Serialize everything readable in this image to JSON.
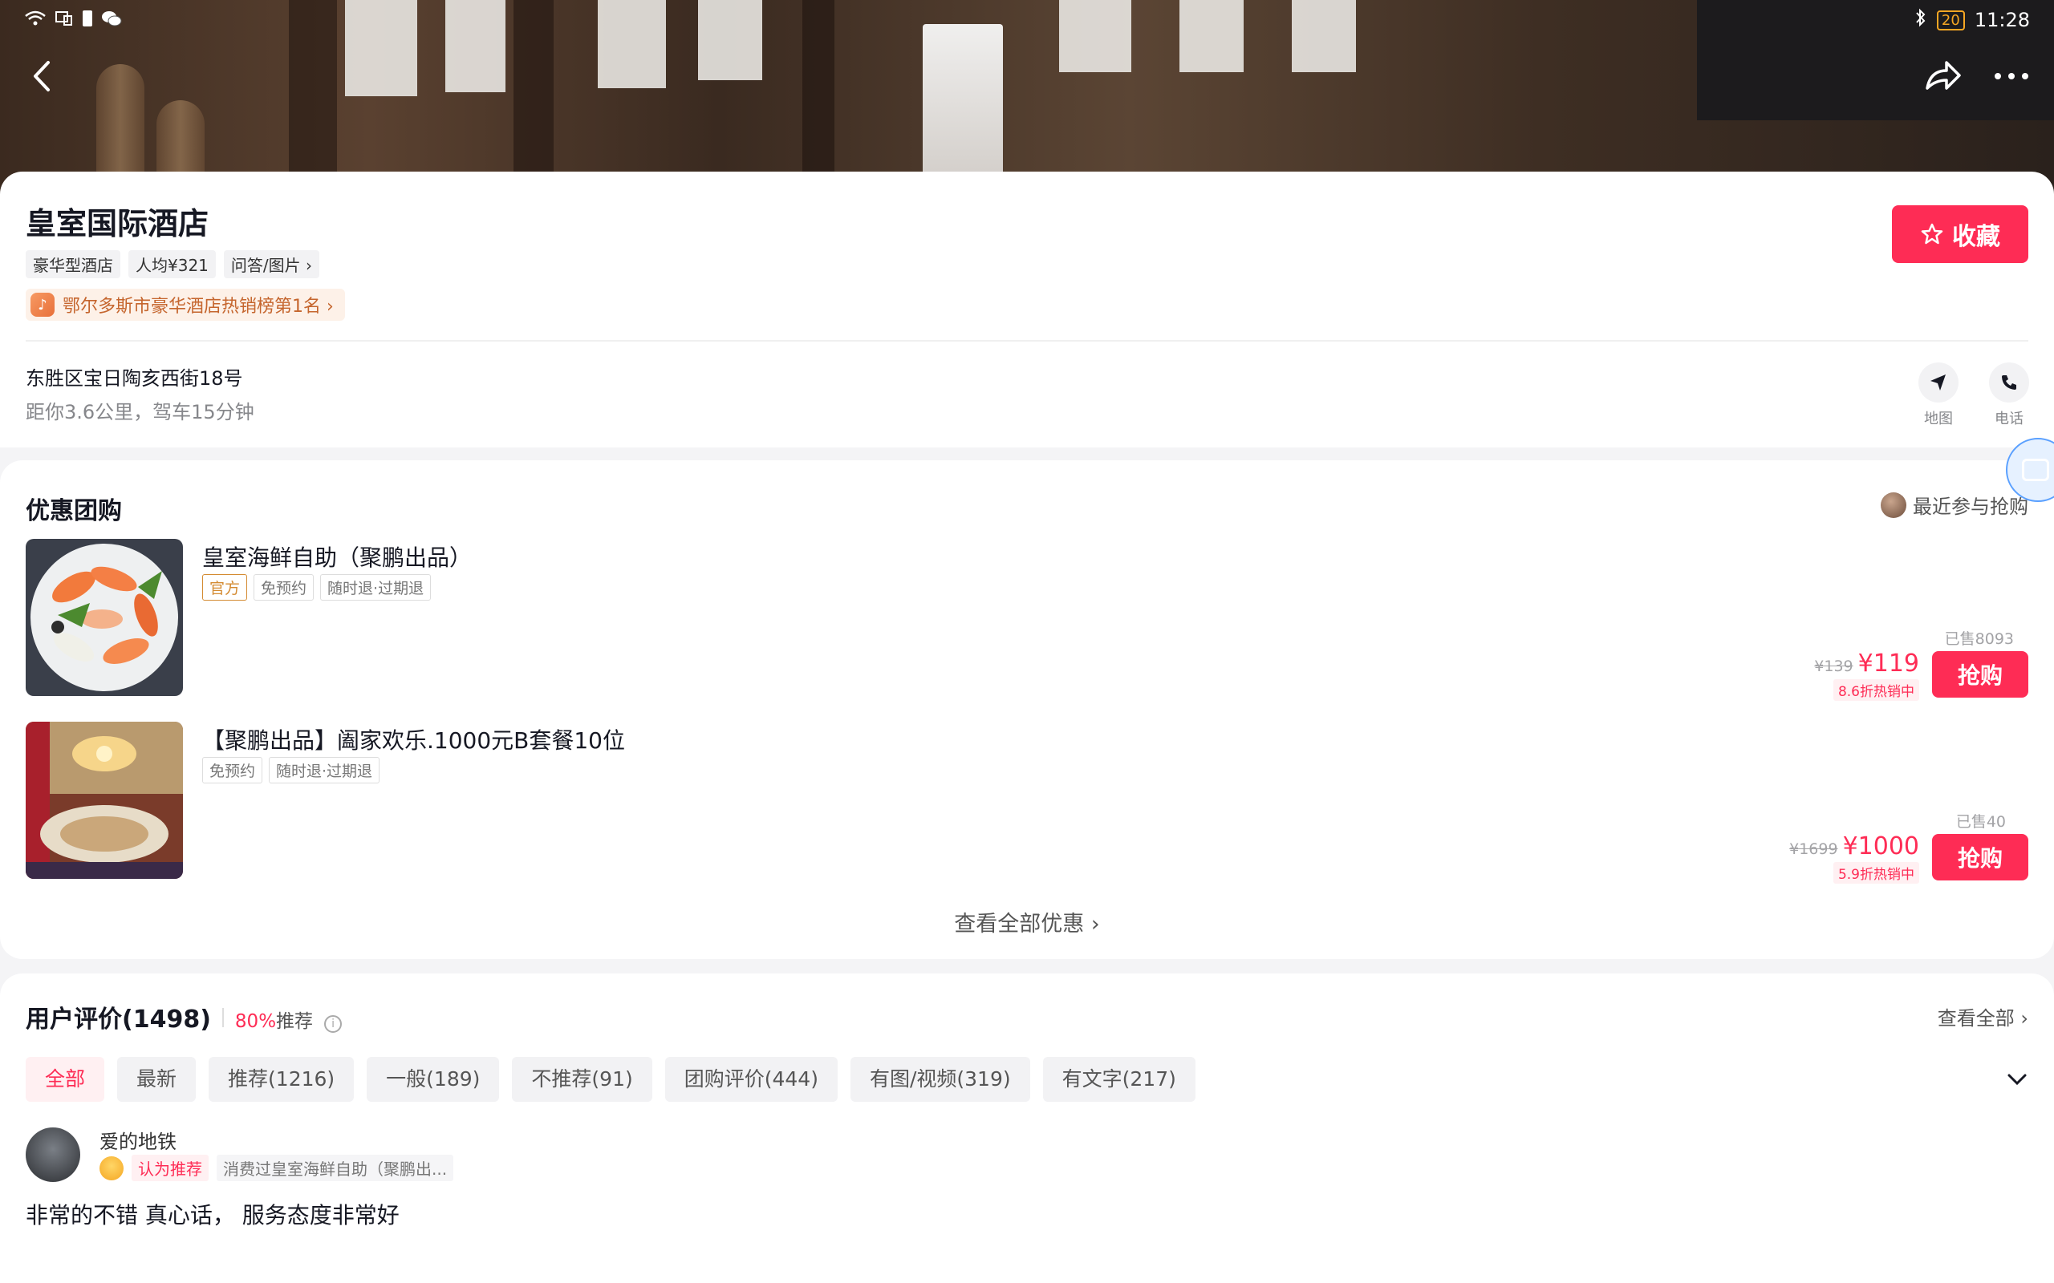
{
  "status_bar": {
    "time": "11:28",
    "battery": "20"
  },
  "hotel": {
    "name": "皇室国际酒店",
    "tags": [
      "豪华型酒店",
      "人均¥321",
      "问答/图片 ›"
    ],
    "rank": "鄂尔多斯市豪华酒店热销榜第1名 ›",
    "favorite_label": "收藏",
    "address": "东胜区宝日陶亥西街18号",
    "distance": "距你3.6公里，驾车15分钟",
    "map_label": "地图",
    "phone_label": "电话"
  },
  "deals": {
    "title": "优惠团购",
    "recent_label": "最近参与抢购",
    "items": [
      {
        "name": "皇室海鲜自助（聚鹏出品）",
        "labels": [
          "官方",
          "免预约",
          "随时退·过期退"
        ],
        "sold": "已售8093",
        "old_price": "¥139",
        "price": "¥119",
        "discount": "8.6折热销中",
        "buy_label": "抢购"
      },
      {
        "name": "【聚鹏出品】阖家欢乐.1000元B套餐10位",
        "labels": [
          "免预约",
          "随时退·过期退"
        ],
        "sold": "已售40",
        "old_price": "¥1699",
        "price": "¥1000",
        "discount": "5.9折热销中",
        "buy_label": "抢购"
      }
    ],
    "see_all": "查看全部优惠 ›"
  },
  "reviews": {
    "title": "用户评价(1498)",
    "percent": "80%",
    "recommend_word": "推荐",
    "view_all": "查看全部 ›",
    "filters": [
      "全部",
      "最新",
      "推荐(1216)",
      "一般(189)",
      "不推荐(91)",
      "团购评价(444)",
      "有图/视频(319)",
      "有文字(217)"
    ],
    "first": {
      "user": "爱的地铁",
      "badge": "认为推荐",
      "consumed": "消费过皇室海鲜自助（聚鹏出...",
      "text": "非常的不错  真心话，   服务态度非常好"
    }
  },
  "colors": {
    "accent": "#fe2c55",
    "rank": "#c5652d",
    "official": "#d48b32"
  }
}
